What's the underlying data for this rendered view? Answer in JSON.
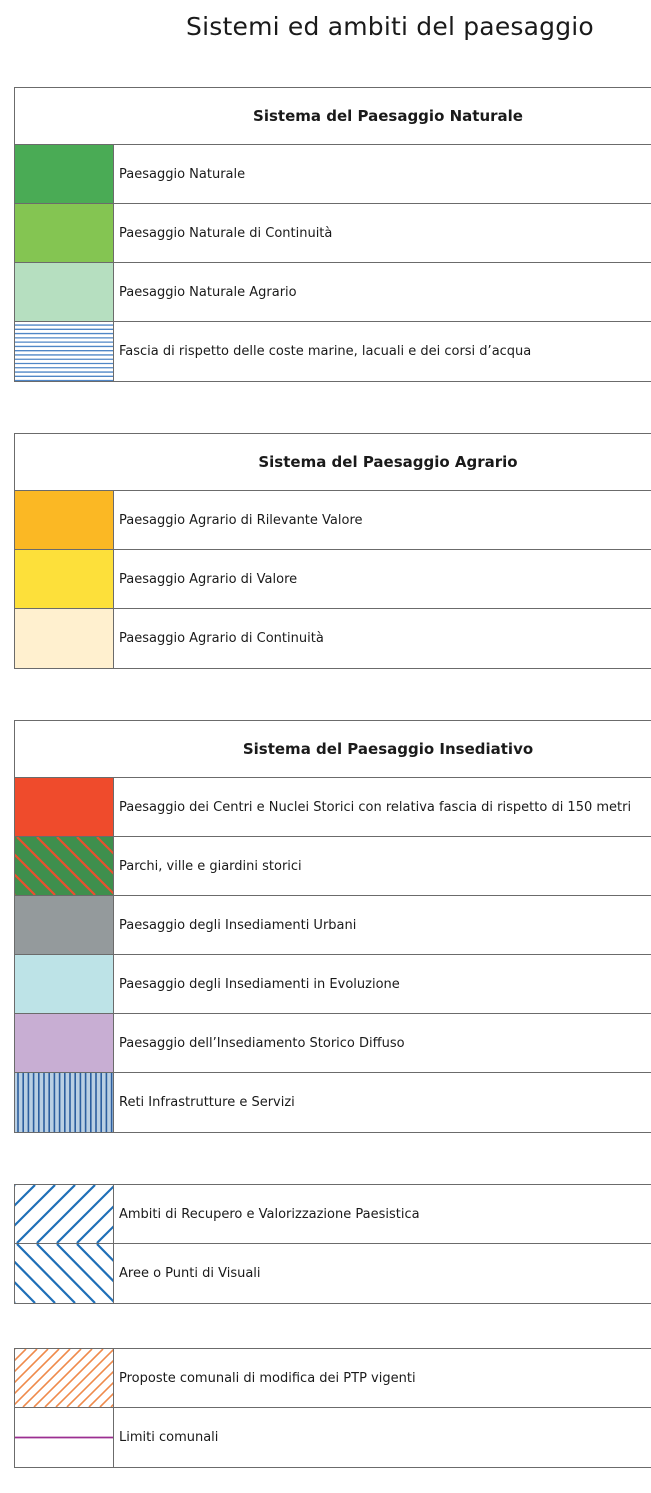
{
  "title": "Sistemi ed ambiti del paesaggio",
  "sections": [
    {
      "header": "Sistema del Paesaggio Naturale",
      "rows": [
        {
          "label": "Paesaggio Naturale",
          "swatch": {
            "type": "solid",
            "color": "#4aab55"
          }
        },
        {
          "label": "Paesaggio Naturale di Continuità",
          "swatch": {
            "type": "solid",
            "color": "#84c552"
          }
        },
        {
          "label": "Paesaggio Naturale Agrario",
          "swatch": {
            "type": "solid",
            "color": "#b6dfc0"
          }
        },
        {
          "label": "Fascia di rispetto delle coste marine, lacuali e dei corsi d’acqua",
          "swatch": {
            "type": "hlines",
            "color": "#4f86c6",
            "bg": "#ffffff"
          }
        }
      ]
    },
    {
      "header": "Sistema del Paesaggio Agrario",
      "rows": [
        {
          "label": "Paesaggio Agrario di Rilevante Valore",
          "swatch": {
            "type": "solid",
            "color": "#fbb824"
          }
        },
        {
          "label": "Paesaggio Agrario di Valore",
          "swatch": {
            "type": "solid",
            "color": "#fde03a"
          }
        },
        {
          "label": "Paesaggio Agrario di Continuità",
          "swatch": {
            "type": "solid",
            "color": "#fff0cf"
          }
        }
      ]
    },
    {
      "header": "Sistema del Paesaggio Insediativo",
      "rows": [
        {
          "label": "Paesaggio dei Centri e Nuclei Storici con relativa fascia di rispetto di 150 metri",
          "swatch": {
            "type": "solid",
            "color": "#ef4b2c"
          }
        },
        {
          "label": "Parchi, ville e giardini storici",
          "swatch": {
            "type": "diag-back",
            "color": "#e8502f",
            "bg": "#3f8f4d"
          }
        },
        {
          "label": "Paesaggio degli Insediamenti Urbani",
          "swatch": {
            "type": "solid",
            "color": "#949a9c"
          }
        },
        {
          "label": "Paesaggio degli Insediamenti in Evoluzione",
          "swatch": {
            "type": "solid",
            "color": "#bde3e7"
          }
        },
        {
          "label": "Paesaggio dell’Insediamento Storico Diffuso",
          "swatch": {
            "type": "solid",
            "color": "#c8aed3"
          }
        },
        {
          "label": "Reti Infrastrutture e Servizi",
          "swatch": {
            "type": "vlines",
            "color": "#2c5e9e",
            "bg": "#b9cfe3"
          }
        }
      ]
    },
    {
      "header": "",
      "rows": [
        {
          "label": "Ambiti di Recupero e Valorizzazione Paesistica",
          "swatch": {
            "type": "diag-fwd",
            "color": "#1f6fb7",
            "bg": "#ffffff"
          }
        },
        {
          "label": "Aree o Punti di Visuali",
          "swatch": {
            "type": "diag-back",
            "color": "#1f6fb7",
            "bg": "#ffffff"
          }
        }
      ]
    },
    {
      "header": "",
      "rows": [
        {
          "label": "Proposte comunali di modifica dei PTP vigenti",
          "swatch": {
            "type": "diag-fwd-fine",
            "color": "#ef8a4b",
            "bg": "#ffffff"
          }
        },
        {
          "label": "Limiti comunali",
          "swatch": {
            "type": "line",
            "color": "#9b2f91",
            "bg": "#ffffff"
          }
        }
      ]
    }
  ]
}
